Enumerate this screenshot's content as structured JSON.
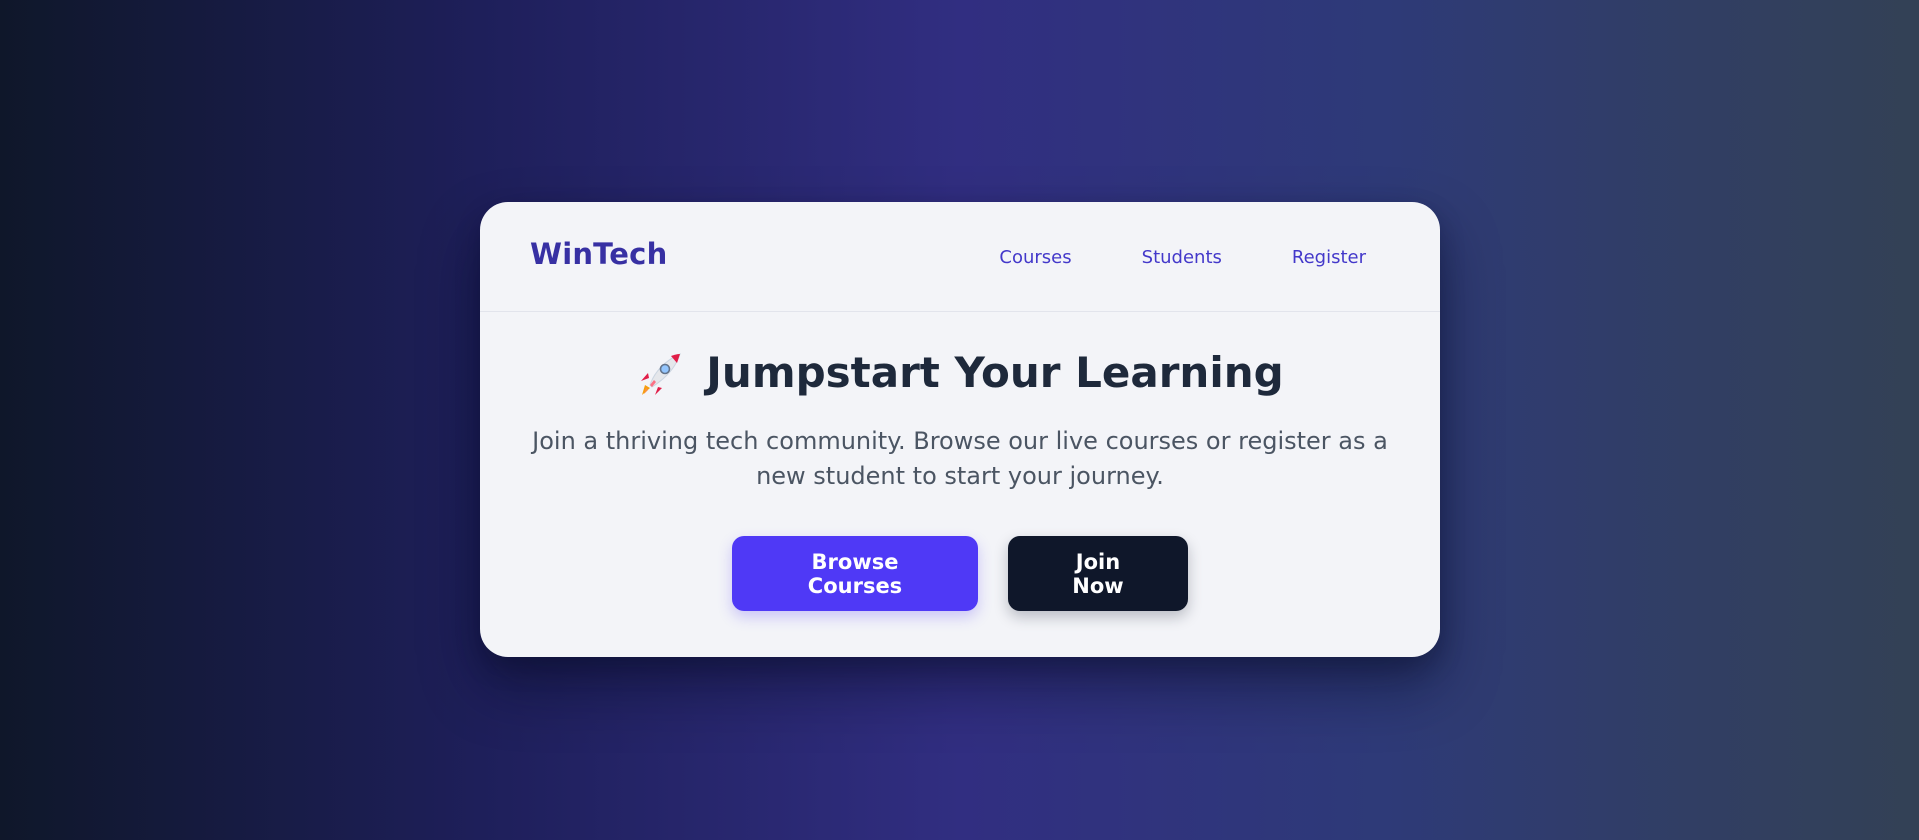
{
  "header": {
    "brand": "WinTech",
    "nav": [
      "Courses",
      "Students",
      "Register"
    ]
  },
  "hero": {
    "icon": "rocket-icon",
    "title": "Jumpstart Your Learning",
    "subtitle": "Join a thriving tech community. Browse our live courses or register as a new student to start your journey."
  },
  "actions": {
    "browse_label": "Browse Courses",
    "join_label": "Join Now"
  },
  "colors": {
    "brand": "#3730a3",
    "nav_link": "#4338ca",
    "primary_button": "#4f39f6",
    "dark_button": "#0f172a",
    "title_text": "#1e293b",
    "card_background": "#f3f4f8"
  }
}
